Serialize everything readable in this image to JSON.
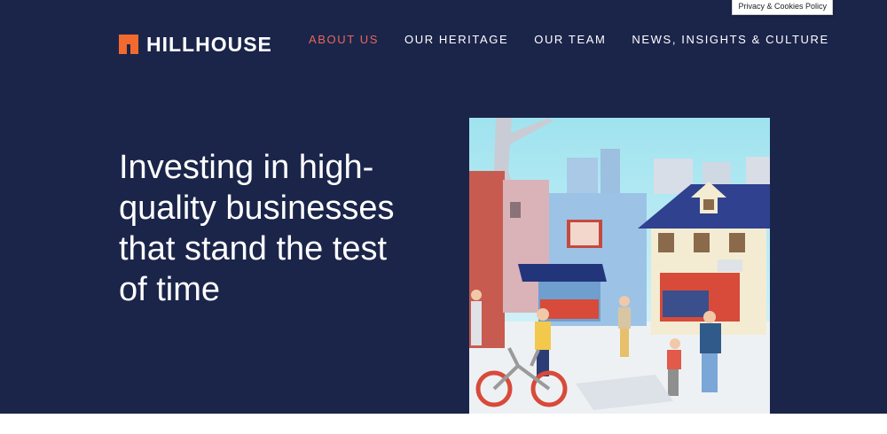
{
  "brand": {
    "name": "HILLHOUSE",
    "accent": "#f26a2e"
  },
  "privacy_link": "Privacy & Cookies Policy",
  "nav": [
    {
      "label": "ABOUT US",
      "active": true
    },
    {
      "label": "OUR HERITAGE",
      "active": false
    },
    {
      "label": "OUR TEAM",
      "active": false
    },
    {
      "label": "NEWS, INSIGHTS & CULTURE",
      "active": false
    }
  ],
  "hero": {
    "headline": "Investing in high-quality businesses that stand the test of time",
    "background": "#1b254a"
  },
  "colors": {
    "nav_active": "#e8665a",
    "nav_text": "#ffffff"
  }
}
